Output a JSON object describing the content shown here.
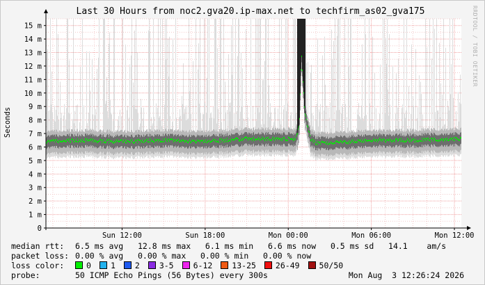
{
  "watermark": "RRDTOOL / TOBI OETIKER",
  "chart_data": {
    "type": "line",
    "title": "Last 30 Hours from noc2.gva20.ip-max.net to techfirm_as02_gva175",
    "ylabel": "Seconds",
    "xlabel": "",
    "ylim": [
      0,
      15.5
    ],
    "yticks": [
      {
        "v": 0,
        "label": "0"
      },
      {
        "v": 1,
        "label": "1 m"
      },
      {
        "v": 2,
        "label": "2 m"
      },
      {
        "v": 3,
        "label": "3 m"
      },
      {
        "v": 4,
        "label": "4 m"
      },
      {
        "v": 5,
        "label": "5 m"
      },
      {
        "v": 6,
        "label": "6 m"
      },
      {
        "v": 7,
        "label": "7 m"
      },
      {
        "v": 8,
        "label": "8 m"
      },
      {
        "v": 9,
        "label": "9 m"
      },
      {
        "v": 10,
        "label": "10 m"
      },
      {
        "v": 11,
        "label": "11 m"
      },
      {
        "v": 12,
        "label": "12 m"
      },
      {
        "v": 13,
        "label": "13 m"
      },
      {
        "v": 14,
        "label": "14 m"
      },
      {
        "v": 15,
        "label": "15 m"
      }
    ],
    "xrange": [
      6.5,
      36.5
    ],
    "xticks": [
      {
        "h": 12,
        "label": "Sun 12:00"
      },
      {
        "h": 18,
        "label": "Sun 18:00"
      },
      {
        "h": 24,
        "label": "Mon 00:00"
      },
      {
        "h": 30,
        "label": "Mon 06:00"
      },
      {
        "h": 36,
        "label": "Mon 12:00"
      }
    ],
    "series": [
      {
        "color": "#00ee00",
        "median_profile": [
          [
            6.5,
            6.4
          ],
          [
            9,
            6.5
          ],
          [
            12,
            6.4
          ],
          [
            15,
            6.5
          ],
          [
            18,
            6.4
          ],
          [
            21,
            6.6
          ],
          [
            24.5,
            6.6
          ],
          [
            24.8,
            7.5
          ],
          [
            24.95,
            13.0
          ],
          [
            25.2,
            8.5
          ],
          [
            25.6,
            6.6
          ],
          [
            26,
            6.3
          ],
          [
            28,
            6.35
          ],
          [
            30,
            6.5
          ],
          [
            33,
            6.5
          ],
          [
            36.5,
            6.6
          ]
        ]
      }
    ]
  },
  "stats": {
    "median_rtt": {
      "label": "median rtt:",
      "text": "6.5 ms avg   12.8 ms max   6.1 ms min   6.6 ms now   0.5 ms sd   14.1    am/s"
    },
    "packet_loss": {
      "label": "packet loss:",
      "text": "0.00 % avg   0.00 % max   0.00 % min   0.00 % now"
    },
    "loss_color": {
      "label": "loss color:",
      "items": [
        {
          "label": "0",
          "color": "#00ee00"
        },
        {
          "label": "1",
          "color": "#22b2ee"
        },
        {
          "label": "2",
          "color": "#1e5aef"
        },
        {
          "label": "3-5",
          "color": "#8a2be2"
        },
        {
          "label": "6-12",
          "color": "#ee22ee"
        },
        {
          "label": "13-25",
          "color": "#f05a14"
        },
        {
          "label": "26-49",
          "color": "#f01010"
        },
        {
          "label": "50/50",
          "color": "#a01010"
        }
      ]
    },
    "probe": {
      "label": "probe:",
      "text": "50 ICMP Echo Pings (56 Bytes) every 300s",
      "date": "Mon Aug  3 12:26:24 2026"
    }
  }
}
